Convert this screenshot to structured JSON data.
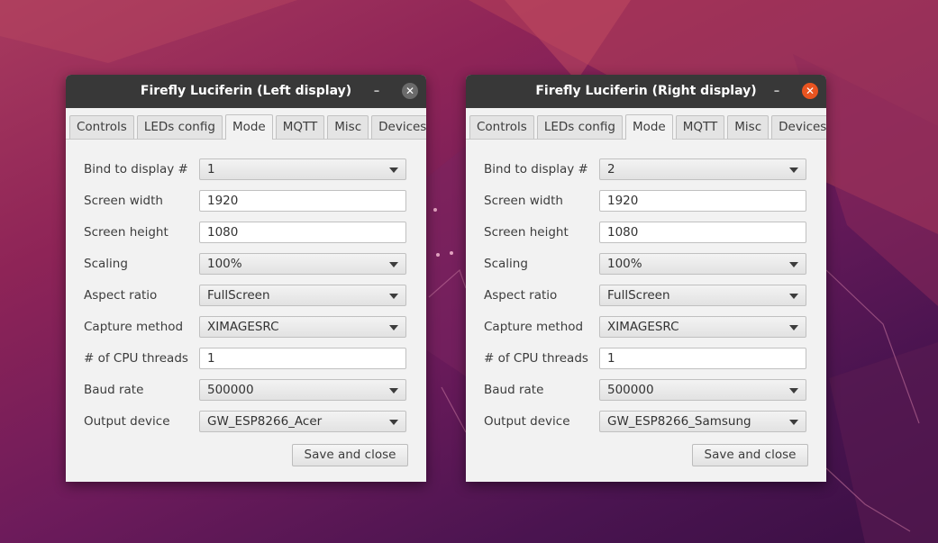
{
  "desktop": {
    "accent_close": "#e95420",
    "titlebar_bg": "#383838"
  },
  "windows": [
    {
      "title": "Firefly Luciferin (Left display)",
      "minimize_glyph": "–",
      "close_glyph": "✕",
      "close_active": false,
      "tabs": [
        "Controls",
        "LEDs config",
        "Mode",
        "MQTT",
        "Misc",
        "Devices"
      ],
      "selected_tab": "Mode",
      "fields": [
        {
          "label": "Bind to display #",
          "value": "1",
          "kind": "combo"
        },
        {
          "label": "Screen width",
          "value": "1920",
          "kind": "text"
        },
        {
          "label": "Screen height",
          "value": "1080",
          "kind": "text"
        },
        {
          "label": "Scaling",
          "value": "100%",
          "kind": "combo"
        },
        {
          "label": "Aspect ratio",
          "value": "FullScreen",
          "kind": "combo"
        },
        {
          "label": "Capture method",
          "value": "XIMAGESRC",
          "kind": "combo"
        },
        {
          "label": "# of CPU threads",
          "value": "1",
          "kind": "text"
        },
        {
          "label": "Baud rate",
          "value": "500000",
          "kind": "combo"
        },
        {
          "label": "Output device",
          "value": "GW_ESP8266_Acer",
          "kind": "combo"
        }
      ],
      "save_label": "Save and close"
    },
    {
      "title": "Firefly Luciferin (Right display)",
      "minimize_glyph": "–",
      "close_glyph": "✕",
      "close_active": true,
      "tabs": [
        "Controls",
        "LEDs config",
        "Mode",
        "MQTT",
        "Misc",
        "Devices"
      ],
      "selected_tab": "Mode",
      "fields": [
        {
          "label": "Bind to display #",
          "value": "2",
          "kind": "combo"
        },
        {
          "label": "Screen width",
          "value": "1920",
          "kind": "text"
        },
        {
          "label": "Screen height",
          "value": "1080",
          "kind": "text"
        },
        {
          "label": "Scaling",
          "value": "100%",
          "kind": "combo"
        },
        {
          "label": "Aspect ratio",
          "value": "FullScreen",
          "kind": "combo"
        },
        {
          "label": "Capture method",
          "value": "XIMAGESRC",
          "kind": "combo"
        },
        {
          "label": "# of CPU threads",
          "value": "1",
          "kind": "text"
        },
        {
          "label": "Baud rate",
          "value": "500000",
          "kind": "combo"
        },
        {
          "label": "Output device",
          "value": "GW_ESP8266_Samsung",
          "kind": "combo"
        }
      ],
      "save_label": "Save and close"
    }
  ]
}
